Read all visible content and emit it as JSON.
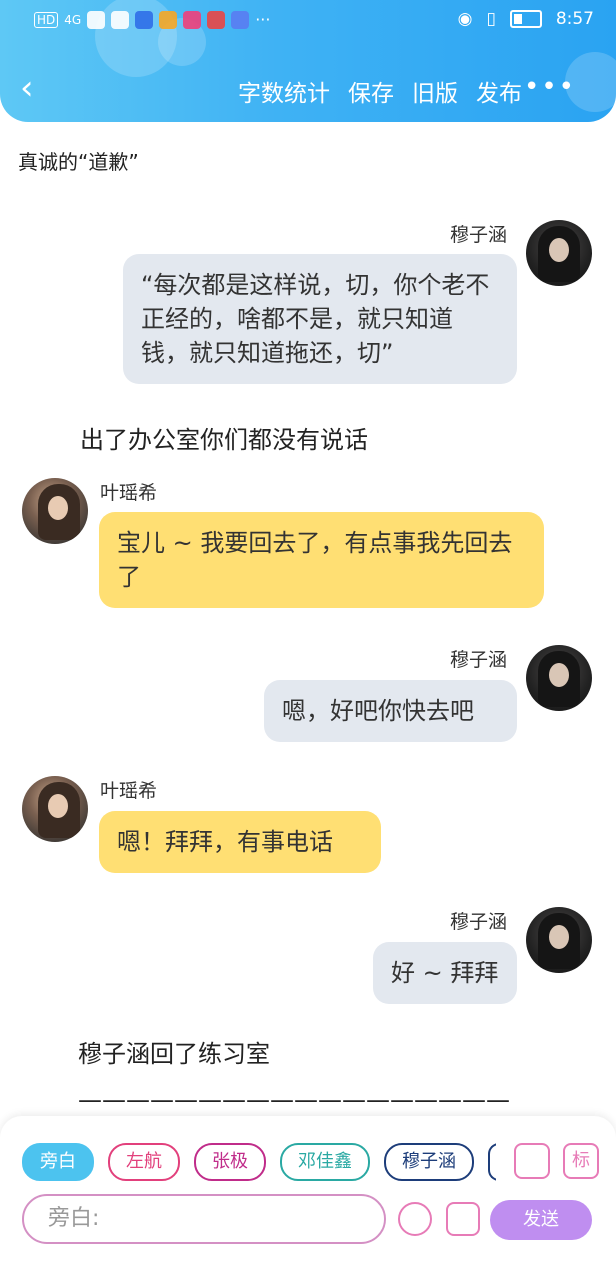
{
  "status": {
    "left_labels": [
      "HD",
      "4G"
    ],
    "time": "8:57"
  },
  "toolbar": {
    "back_icon": "chevron-left-icon",
    "items": [
      "字数统计",
      "保存",
      "旧版",
      "发布"
    ],
    "more_label": "•••"
  },
  "doc": {
    "title": "真诚的“道歉”"
  },
  "messages": [
    {
      "speaker": "穆子涵",
      "side": "right",
      "style": "gray",
      "text": "“每次都是这样说，切，你个老不正经的，啥都不是，就只知道钱，就只知道拖还，切”"
    },
    {
      "narration": "出了办公室你们都没有说话"
    },
    {
      "speaker": "叶瑶希",
      "side": "left",
      "style": "yellow",
      "text": "宝儿 ~ 我要回去了，有点事我先回去了"
    },
    {
      "speaker": "穆子涵",
      "side": "right",
      "style": "gray",
      "text": "嗯，好吧你快去吧"
    },
    {
      "speaker": "叶瑶希",
      "side": "left",
      "style": "yellow",
      "text": "嗯！拜拜，有事电话"
    },
    {
      "speaker": "穆子涵",
      "side": "right",
      "style": "gray",
      "text": "好 ~ 拜拜"
    },
    {
      "narration": "穆子涵回了练习室"
    },
    {
      "narration": "——————————————————"
    }
  ],
  "composer": {
    "roles": [
      "旁白",
      "左航",
      "张极",
      "邓佳鑫",
      "穆子涵"
    ],
    "active_role": "旁白",
    "input_placeholder": "旁白:",
    "send_label": "发送",
    "mark_label": "标"
  }
}
